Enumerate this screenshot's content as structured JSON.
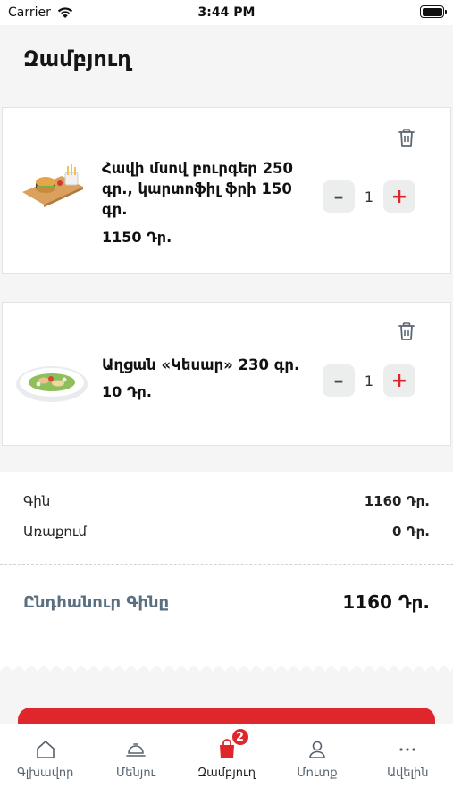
{
  "status_bar": {
    "carrier": "Carrier",
    "time": "3:44 PM"
  },
  "page": {
    "title": "Զամբյուղ"
  },
  "cart": {
    "items": [
      {
        "name_lines": [
          "Հավի մսով բուրգեր 250",
          "գր., կարտոֆիլ ֆրի 150",
          "գր."
        ],
        "price": "1150 Դր.",
        "quantity": "1",
        "decrease": "–",
        "increase": "+",
        "icon": "burger-fries-image"
      },
      {
        "name_lines": [
          "Աղցան «Կեսար» 230 գր."
        ],
        "price": "10 Դր.",
        "quantity": "1",
        "decrease": "–",
        "increase": "+",
        "icon": "caesar-salad-image"
      }
    ]
  },
  "summary": {
    "price_label": "Գին",
    "price_value": "1160 Դր.",
    "delivery_label": "Առաքում",
    "delivery_value": "0 Դր.",
    "total_label": "Ընդհանուր Գինը",
    "total_value": "1160 Դր."
  },
  "tabs": [
    {
      "label": "Գլխավոր",
      "icon": "home-icon"
    },
    {
      "label": "Մենյու",
      "icon": "cloche-icon"
    },
    {
      "label": "Զամբյուղ",
      "icon": "shopping-bag-icon",
      "badge": "2",
      "active": true
    },
    {
      "label": "Մուտք",
      "icon": "user-icon"
    },
    {
      "label": "Ավելին",
      "icon": "more-icon"
    }
  ],
  "colors": {
    "accent": "#e0262d",
    "total_label": "#5a6f82",
    "background": "#f4f5f4"
  }
}
